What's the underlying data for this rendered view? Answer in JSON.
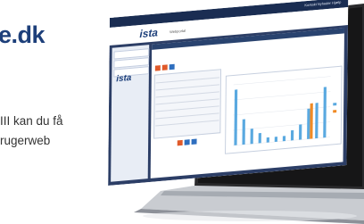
{
  "hero": {
    "headline": "e.dk",
    "line1": "III kan du få",
    "line2": "rugerweb"
  },
  "app": {
    "logo": "ista",
    "portal_label": "Webportal",
    "top_links": "Kontakt  Nyheder  Hjælp",
    "side_logo": "ista"
  },
  "chart_data": {
    "type": "bar",
    "categories": [
      "1",
      "2",
      "3",
      "4",
      "5",
      "6",
      "7",
      "8",
      "9",
      "10",
      "11",
      "12"
    ],
    "series": [
      {
        "values": [
          11,
          5,
          3,
          2,
          1,
          1,
          1,
          2,
          3,
          6,
          7,
          10
        ]
      },
      {
        "values": [
          0,
          0,
          0,
          0,
          0,
          0,
          0,
          0,
          0,
          7,
          0,
          0
        ]
      }
    ],
    "colors": [
      "#5aa9e0",
      "#f08a24"
    ],
    "ylim": [
      0,
      12
    ],
    "grid": true
  }
}
